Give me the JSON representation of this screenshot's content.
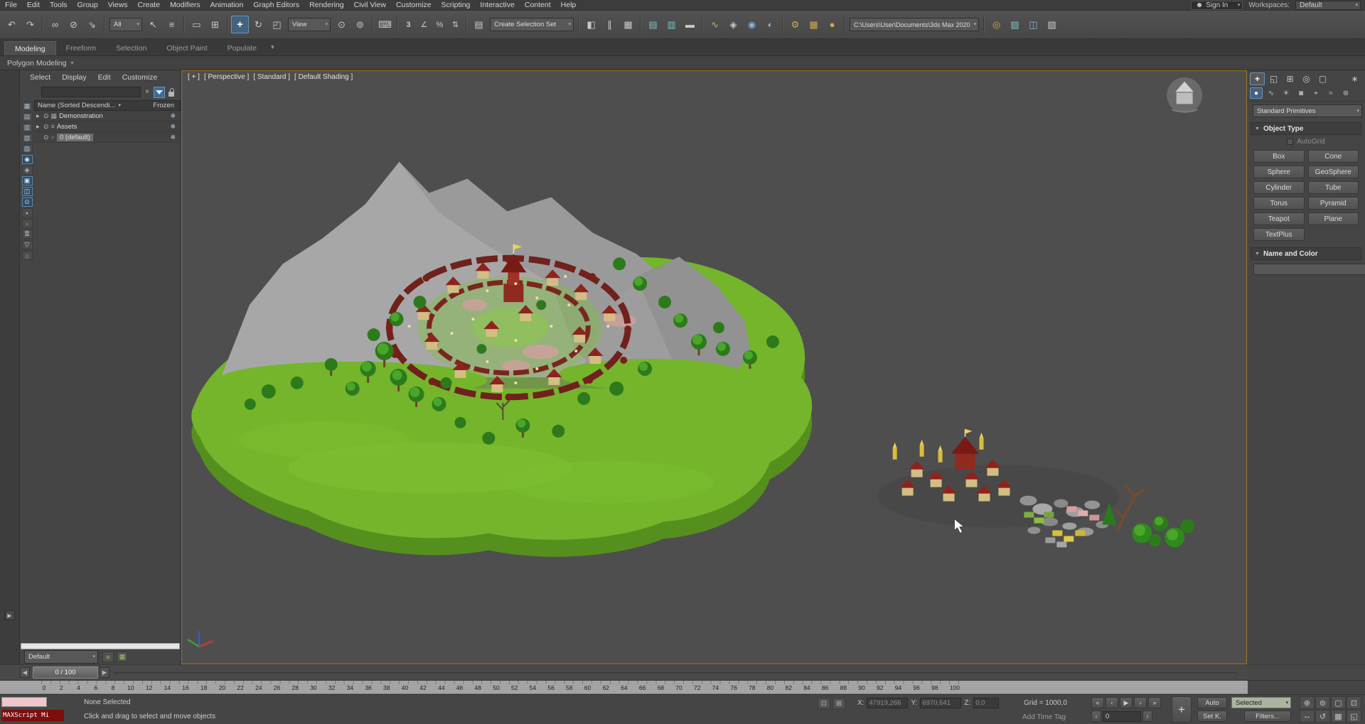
{
  "colors": {
    "accent_border": "#a0762a",
    "swatch": "#e6007e"
  },
  "menubar": {
    "items": [
      "File",
      "Edit",
      "Tools",
      "Group",
      "Views",
      "Create",
      "Modifiers",
      "Animation",
      "Graph Editors",
      "Rendering",
      "Civil View",
      "Customize",
      "Scripting",
      "Interactive",
      "Content",
      "Help"
    ],
    "sign_in": "Sign In",
    "workspaces_label": "Workspaces:",
    "workspace_value": "Default"
  },
  "toolbar": {
    "selection_filter_value": "All",
    "ref_coord_value": "View",
    "selection_set_value": "Create Selection Set",
    "project_path": "C:\\Users\\User\\Documents\\3ds Max 2020"
  },
  "ribbon": {
    "tabs": [
      "Modeling",
      "Freeform",
      "Selection",
      "Object Paint",
      "Populate"
    ],
    "strip_label": "Polygon Modeling"
  },
  "scene_explorer": {
    "menus": [
      "Select",
      "Display",
      "Edit",
      "Customize"
    ],
    "header_name": "Name (Sorted Descendi...",
    "header_frozen": "Frozen",
    "rows": [
      "Demonstration",
      "Assets",
      "0 (default)"
    ],
    "footer_value": "Default"
  },
  "viewport": {
    "label_general": "[ + ]",
    "label_pov": "[ Perspective ]",
    "label_standard": "[ Standard ]",
    "label_shading": "[ Default Shading ]"
  },
  "command_panel": {
    "category_value": "Standard Primitives",
    "object_type_label": "Object Type",
    "autogrid_label": "AutoGrid",
    "primitive_buttons": [
      "Box",
      "Cone",
      "Sphere",
      "GeoSphere",
      "Cylinder",
      "Tube",
      "Torus",
      "Pyramid",
      "Teapot",
      "Plane",
      "TextPlus"
    ],
    "name_color_label": "Name and Color"
  },
  "timeline": {
    "slider_label": "0 / 100",
    "ticks": [
      0,
      2,
      4,
      6,
      8,
      10,
      12,
      14,
      16,
      18,
      20,
      22,
      24,
      26,
      28,
      30,
      32,
      34,
      36,
      38,
      40,
      42,
      44,
      46,
      48,
      50,
      52,
      54,
      56,
      58,
      60,
      62,
      64,
      66,
      68,
      70,
      72,
      74,
      76,
      78,
      80,
      82,
      84,
      86,
      88,
      90,
      92,
      94,
      96,
      98,
      100
    ]
  },
  "statusbar": {
    "maxscript_label": "MAXScript Mi",
    "selection_status": "None Selected",
    "prompt": "Click and drag to select and move objects",
    "x_label": "X:",
    "x_value": "47919,266",
    "y_label": "Y:",
    "y_value": "6970,641",
    "z_label": "Z:",
    "z_value": "0,0",
    "grid_label": "Grid = 1000,0",
    "time_tag_label": "Add Time Tag",
    "auto_key_label": "Auto",
    "selected_filter_value": "Selected",
    "set_key_label": "Set K.",
    "key_filters_label": "Filters...",
    "frame_value": "0"
  }
}
